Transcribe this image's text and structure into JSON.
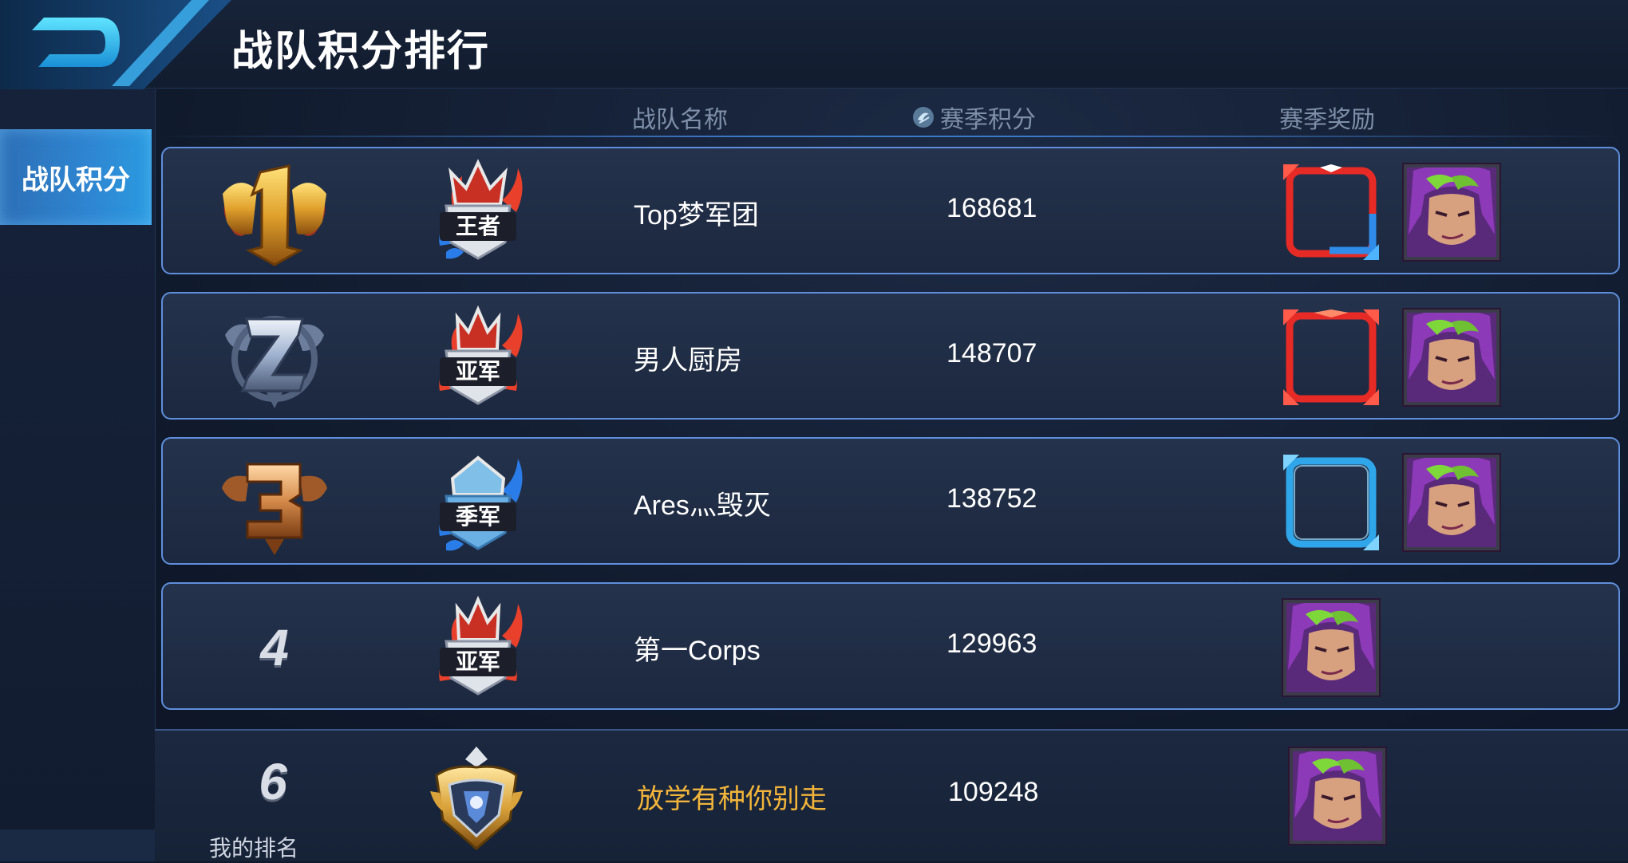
{
  "header": {
    "title": "战队积分排行",
    "back_icon": "back-arrow-icon"
  },
  "sidebar": {
    "tabs": [
      {
        "label": "战队积分",
        "active": true
      }
    ]
  },
  "columns": {
    "team_name": "战队名称",
    "season_points": "赛季积分",
    "season_reward": "赛季奖励",
    "points_icon": "points-icon"
  },
  "rows": [
    {
      "rank": "1",
      "rank_icon": "gold-rank-1-icon",
      "tier_badge": "王者",
      "team": "Top梦军团",
      "score": "168681",
      "rewards": [
        "red-blue-avatar-frame",
        "hero-portrait"
      ]
    },
    {
      "rank": "2",
      "rank_icon": "silver-rank-2-icon",
      "tier_badge": "亚军",
      "team": "男人厨房",
      "score": "148707",
      "rewards": [
        "red-avatar-frame",
        "hero-portrait"
      ]
    },
    {
      "rank": "3",
      "rank_icon": "bronze-rank-3-icon",
      "tier_badge": "季军",
      "team": "Ares灬毁灭",
      "score": "138752",
      "rewards": [
        "blue-avatar-frame",
        "hero-portrait"
      ]
    },
    {
      "rank": "4",
      "tier_badge": "亚军",
      "team": "第一Corps",
      "score": "129963",
      "rewards": [
        "hero-portrait"
      ]
    }
  ],
  "my_rank": {
    "rank": "6",
    "label": "我的排名",
    "tier_badge_icon": "gold-tier-badge-icon",
    "team": "放学有种你别走",
    "score": "109248",
    "rewards": [
      "hero-portrait"
    ]
  },
  "colors": {
    "row_border": "#5f8fdc",
    "my_team_name": "#f2b43a",
    "sidebar_active": "#2f86d2"
  }
}
